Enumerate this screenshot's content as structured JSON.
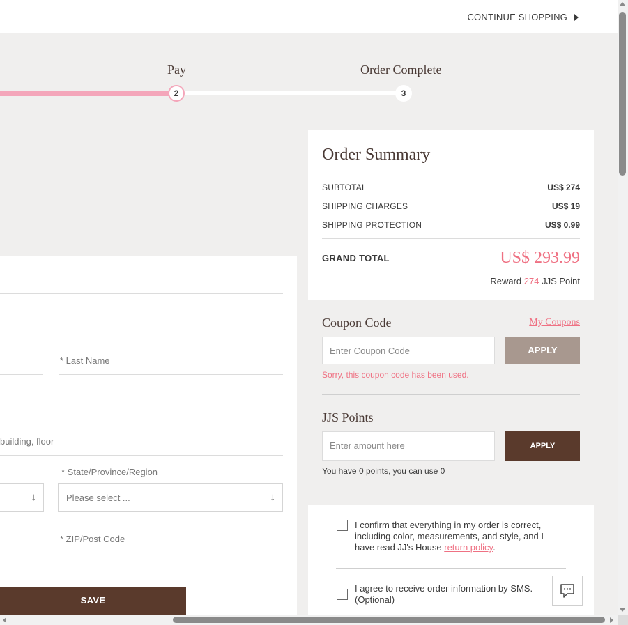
{
  "header": {
    "continue_label": "CONTINUE SHOPPING"
  },
  "progress": {
    "steps": [
      {
        "label": "Pay",
        "number": "2"
      },
      {
        "label": "Order Complete",
        "number": "3"
      }
    ]
  },
  "form": {
    "last_name_label": "* Last Name",
    "address2_label": "building, floor",
    "state_label": "* State/Province/Region",
    "state_placeholder": "Please select ...",
    "zip_label": "* ZIP/Post Code",
    "save_label": "SAVE"
  },
  "summary": {
    "title": "Order Summary",
    "rows": [
      {
        "label": "SUBTOTAL",
        "value": "US$ 274"
      },
      {
        "label": "SHIPPING CHARGES",
        "value": "US$ 19"
      },
      {
        "label": "SHIPPING PROTECTION",
        "value": "US$ 0.99"
      }
    ],
    "grand_total_label": "GRAND TOTAL",
    "grand_total_value": "US$ 293.99",
    "reward_prefix": "Reward",
    "reward_points": "274",
    "reward_suffix": "JJS Point"
  },
  "coupon": {
    "title": "Coupon Code",
    "my_coupons": "My Coupons",
    "placeholder": "Enter Coupon Code",
    "apply_label": "APPLY",
    "error": "Sorry, this coupon code has been used."
  },
  "points": {
    "title": "JJS Points",
    "placeholder": "Enter amount here",
    "apply_label": "APPLY",
    "note": "You have 0 points, you can use 0"
  },
  "confirm": {
    "line1": "I confirm that everything in my order is correct,",
    "line2": "including color, measurements, and style, and I",
    "line3_prefix": "have read JJ's House",
    "return_policy": "return policy",
    "line3_suffix": ".",
    "sms_line1": "I agree to receive order information by SMS.",
    "sms_line2": "(Optional)"
  },
  "colors": {
    "accent_pink": "#ef7183",
    "brand_brown": "#5a3a2c",
    "progress_pink": "#f4a6ba"
  },
  "icons": {
    "continue": "triangle-right-icon",
    "select": "arrow-down-icon",
    "chat": "chat-bubble-icon"
  }
}
